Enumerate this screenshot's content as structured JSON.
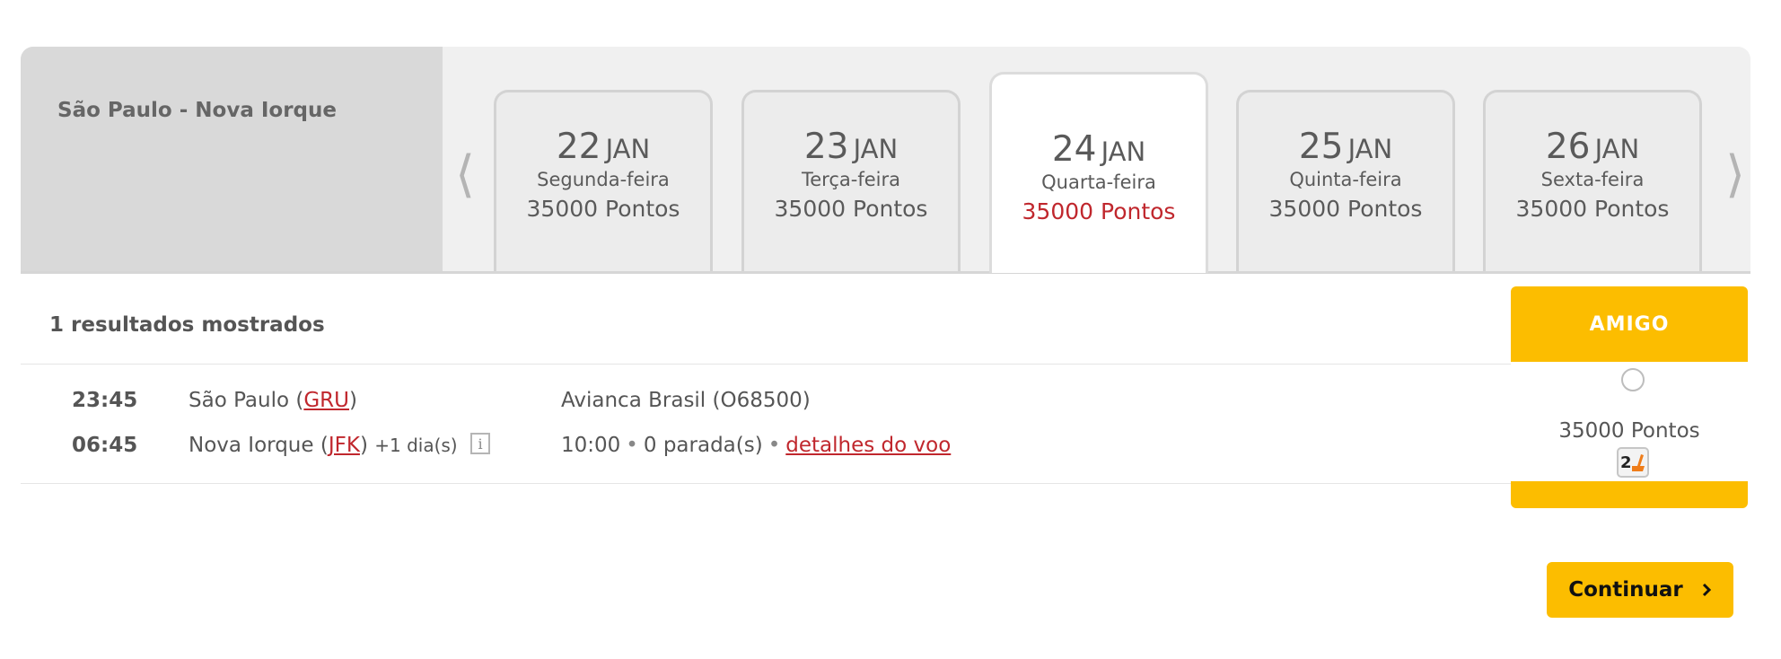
{
  "route": {
    "title": "São Paulo - Nova Iorque"
  },
  "date_tabs": [
    {
      "day": "22",
      "month": "JAN",
      "weekday": "Segunda-feira",
      "points": "35000 Pontos",
      "selected": false
    },
    {
      "day": "23",
      "month": "JAN",
      "weekday": "Terça-feira",
      "points": "35000 Pontos",
      "selected": false
    },
    {
      "day": "24",
      "month": "JAN",
      "weekday": "Quarta-feira",
      "points": "35000 Pontos",
      "selected": true
    },
    {
      "day": "25",
      "month": "JAN",
      "weekday": "Quinta-feira",
      "points": "35000 Pontos",
      "selected": false
    },
    {
      "day": "26",
      "month": "JAN",
      "weekday": "Sexta-feira",
      "points": "35000 Pontos",
      "selected": false
    }
  ],
  "nav": {
    "prev_icon": "chevron-left-icon",
    "next_icon": "chevron-right-icon"
  },
  "results": {
    "count_label": "1 resultados mostrados"
  },
  "fare_column": {
    "title": "AMIGO"
  },
  "flight": {
    "departure_time": "23:45",
    "arrival_time": "06:45",
    "origin_city": "São Paulo",
    "origin_code": "GRU",
    "destination_city": "Nova Iorque",
    "destination_code": "JFK",
    "day_offset": "+1 dia(s)",
    "airline": "Avianca Brasil (O68500)",
    "duration": "10:00",
    "stops": "0 parada(s)",
    "details_link": "detalhes do voo",
    "fare_points": "35000 Pontos",
    "seats_left": "2"
  },
  "actions": {
    "continue_label": "Continuar"
  },
  "colors": {
    "accent": "#fcbd00",
    "link": "#c0272d",
    "selected_points": "#c0272d"
  }
}
